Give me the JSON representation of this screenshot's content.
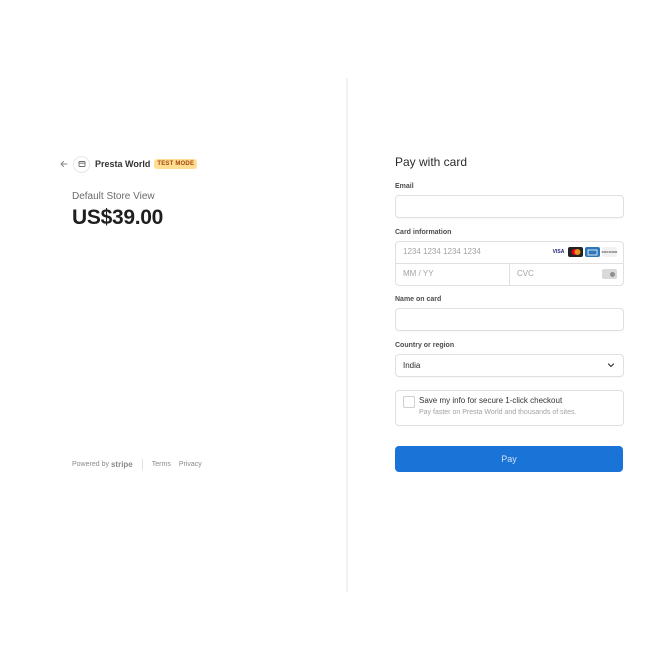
{
  "merchant": {
    "name": "Presta World",
    "test_mode_label": "TEST MODE"
  },
  "summary": {
    "product_name": "Default Store View",
    "price": "US$39.00"
  },
  "footer": {
    "powered_by": "Powered by",
    "stripe": "stripe",
    "terms": "Terms",
    "privacy": "Privacy"
  },
  "form": {
    "heading": "Pay with card",
    "email_label": "Email",
    "email_value": "",
    "card_label": "Card information",
    "card_number_placeholder": "1234 1234 1234 1234",
    "expiry_placeholder": "MM / YY",
    "cvc_placeholder": "CVC",
    "card_brands": [
      {
        "name": "visa-icon",
        "text": "VISA",
        "color": "#1a1f71"
      },
      {
        "name": "mastercard-icon",
        "text": "",
        "color": "#222222"
      },
      {
        "name": "amex-icon",
        "text": "AMEX",
        "color": "#2e77bb"
      },
      {
        "name": "discover-icon",
        "text": "DISCOVER",
        "color": "#f2f2f2"
      }
    ],
    "name_label": "Name on card",
    "name_value": "",
    "country_label": "Country or region",
    "country_value": "India",
    "save_title": "Save my info for secure 1-click checkout",
    "save_subtitle": "Pay faster on Presta World and thousands of sites.",
    "pay_label": "Pay"
  },
  "colors": {
    "pay_button": "#1a74d8",
    "test_badge": "#ffde92"
  }
}
